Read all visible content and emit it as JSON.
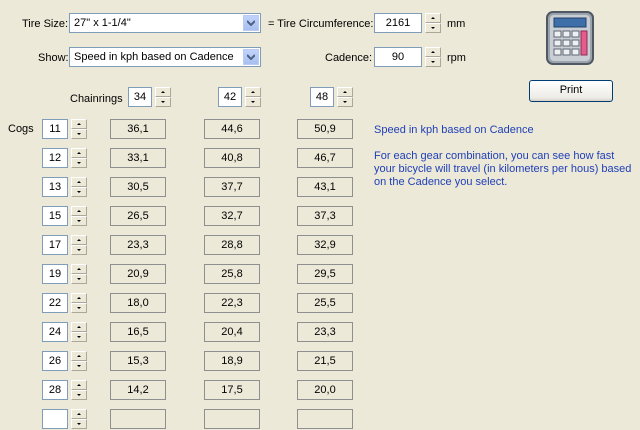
{
  "tire_size": {
    "label": "Tire Size:",
    "value": "27\" x 1-1/4\""
  },
  "show": {
    "label": "Show:",
    "value": "Speed in kph based on Cadence"
  },
  "circumference": {
    "label": "= Tire Circumference:",
    "value": "2161",
    "unit": "mm"
  },
  "cadence": {
    "label": "Cadence:",
    "value": "90",
    "unit": "rpm"
  },
  "print_label": "Print",
  "chainrings_label": "Chainrings",
  "cogs_label": "Cogs",
  "chainrings": [
    "34",
    "42",
    "48"
  ],
  "cogs": [
    "11",
    "12",
    "13",
    "15",
    "17",
    "19",
    "22",
    "24",
    "26",
    "28",
    ""
  ],
  "speeds": [
    [
      "36,1",
      "44,6",
      "50,9"
    ],
    [
      "33,1",
      "40,8",
      "46,7"
    ],
    [
      "30,5",
      "37,7",
      "43,1"
    ],
    [
      "26,5",
      "32,7",
      "37,3"
    ],
    [
      "23,3",
      "28,8",
      "32,9"
    ],
    [
      "20,9",
      "25,8",
      "29,5"
    ],
    [
      "18,0",
      "22,3",
      "25,5"
    ],
    [
      "16,5",
      "20,4",
      "23,3"
    ],
    [
      "15,3",
      "18,9",
      "21,5"
    ],
    [
      "14,2",
      "17,5",
      "20,0"
    ],
    [
      "",
      "",
      ""
    ]
  ],
  "info_title": "Speed in kph based on Cadence",
  "info_lines": [
    "For each gear combination, you can see how fast",
    "your bicycle will travel (in kilometers per hous) based",
    "on the Cadence you select."
  ],
  "icon": "calculator-icon",
  "colors": {
    "background": "#ECE9D8",
    "info_text": "#1F3FB7",
    "field_border": "#7F9DB9"
  }
}
